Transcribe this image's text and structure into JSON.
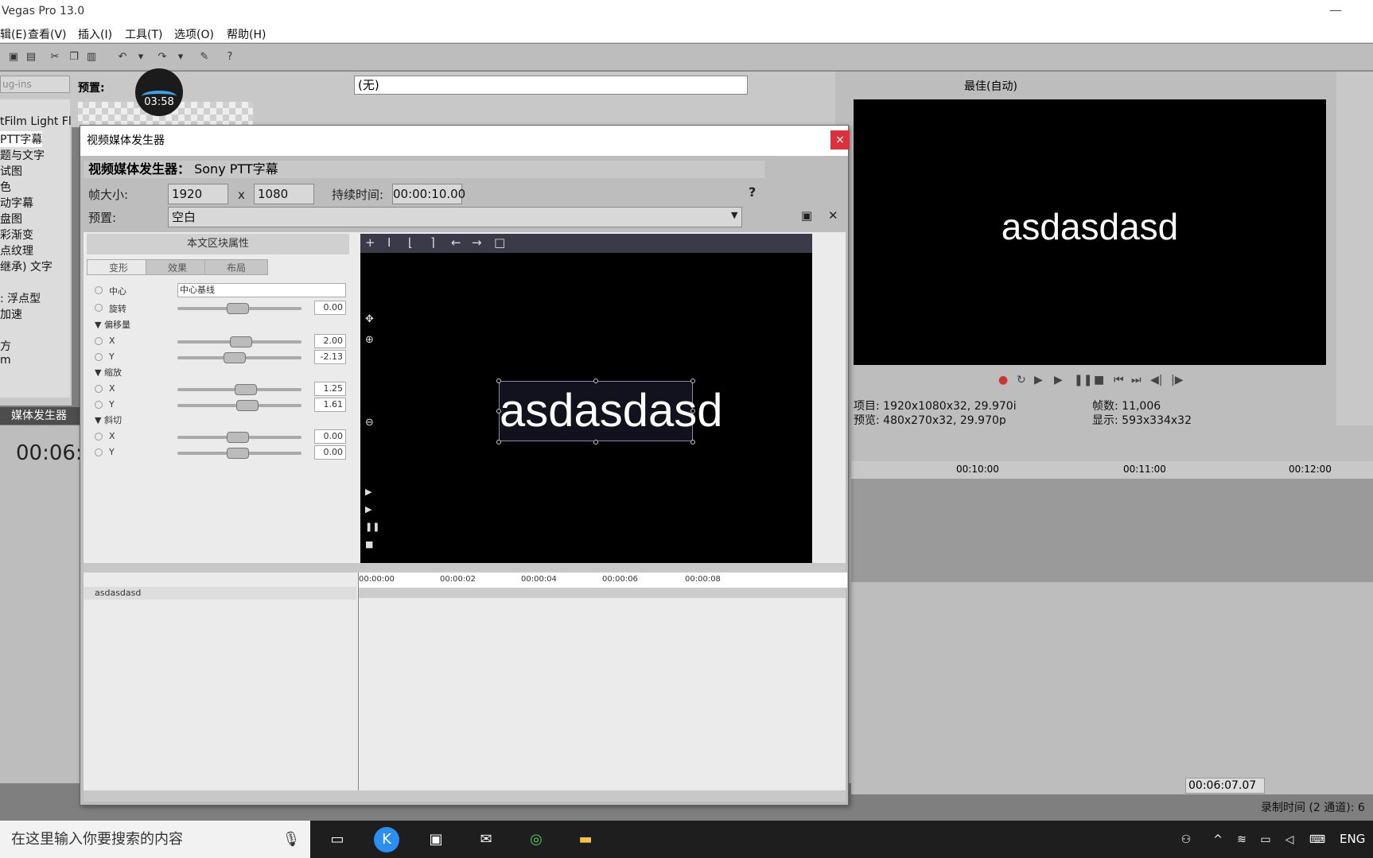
{
  "app": {
    "title": "Vegas Pro 13.0",
    "min_label": "—"
  },
  "menu": [
    "辑(E)",
    "查看(V)",
    "插入(I)",
    "工具(T)",
    "选项(O)",
    "帮助(H)"
  ],
  "plugins": {
    "search_placeholder": "ug-ins",
    "items": [
      "tFilm Light Flar",
      "PTT字幕",
      "题与文字",
      "试图",
      "色",
      "动字幕",
      "盘图",
      "彩渐变",
      "点纹理",
      "继承) 文字",
      "",
      "浮点型",
      "加速",
      "",
      "方",
      "m"
    ],
    "tab_label": "媒体发生器"
  },
  "preset_label": "预置:",
  "timer": "03:58",
  "upper_combo": "(无)",
  "preview": {
    "quality": "最佳(自动)",
    "text": "asdasdasd",
    "project": "项目: 1920x1080x32, 29.970i",
    "preview": "预览: 480x270x32, 29.970p",
    "frames": "帧数: 11,006",
    "display": "显示: 593x334x32"
  },
  "timeline": {
    "current_time": "00:06:",
    "ruler": [
      "00:10:00",
      "00:11:00",
      "00:12:00"
    ],
    "end_time": "00:06:07.07",
    "record_time": "录制时间 (2 通道): 6"
  },
  "dialog": {
    "title": "视频媒体发生器",
    "close": "×",
    "subtitle_label": "视频媒体发生器：",
    "subtitle_value": "Sony PTT字幕",
    "frame_size_label": "帧大小:",
    "width": "1920",
    "x": "x",
    "height": "1080",
    "duration_label": "持续时间:",
    "duration": "00:00:10.00",
    "preset_label": "预置:",
    "preset_value": "空白",
    "help": "?",
    "props": {
      "header": "本文区块属性",
      "tabs": [
        "变形",
        "效果",
        "布局"
      ],
      "center_label": "中心",
      "center_value": "中心基线",
      "rotate_label": "旋转",
      "rotate_value": "0.00",
      "offset_label": "偏移量",
      "offset_x": "2.00",
      "offset_y": "-2.13",
      "scale_label": "缩放",
      "scale_x": "1.25",
      "scale_y": "1.61",
      "skew_label": "斜切",
      "skew_x": "0.00",
      "skew_y": "0.00",
      "x": "X",
      "y": "Y"
    },
    "canvas_text": "asdasdasd",
    "track_name": "asdasdasd",
    "tl_ruler": [
      "00:00:00",
      "00:00:02",
      "00:00:04",
      "00:00:06",
      "00:00:08"
    ]
  },
  "taskbar": {
    "search": "在这里输入你要搜索的内容",
    "lang": "ENG"
  }
}
